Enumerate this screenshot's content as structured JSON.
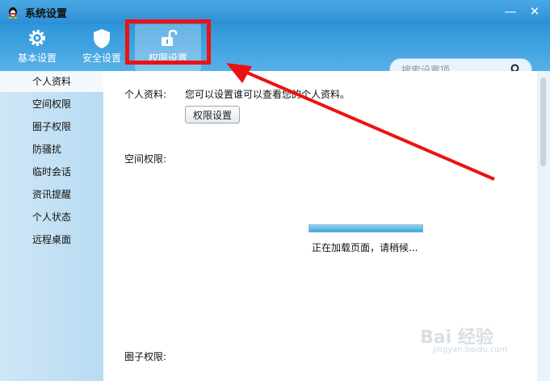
{
  "window": {
    "title": "系统设置",
    "minimize": "—",
    "close": "✕"
  },
  "toolbar": {
    "items": [
      {
        "label": "基本设置",
        "icon": "gear-icon"
      },
      {
        "label": "安全设置",
        "icon": "shield-icon"
      },
      {
        "label": "权限设置",
        "icon": "unlock-icon",
        "active": true
      }
    ]
  },
  "search": {
    "placeholder": "搜索设置项"
  },
  "sidebar": {
    "items": [
      {
        "label": "个人资料",
        "active": true
      },
      {
        "label": "空间权限"
      },
      {
        "label": "圈子权限"
      },
      {
        "label": "防骚扰"
      },
      {
        "label": "临时会话"
      },
      {
        "label": "资讯提醒"
      },
      {
        "label": "个人状态"
      },
      {
        "label": "远程桌面"
      }
    ]
  },
  "main": {
    "profile_label": "个人资料:",
    "profile_desc": "您可以设置谁可以查看您的个人资料。",
    "permission_button": "权限设置",
    "space_label": "空间权限:",
    "loading_text": "正在加载页面，请稍候...",
    "loading_progress": 1.0,
    "circle_label": "圈子权限:"
  },
  "watermark": {
    "text": "Bai 经验",
    "sub": "jingyan.baidu.com"
  },
  "colors": {
    "highlight": "#ee1111",
    "titlebar": "#2b8fd6",
    "sidebar": "#c4e1f4"
  }
}
